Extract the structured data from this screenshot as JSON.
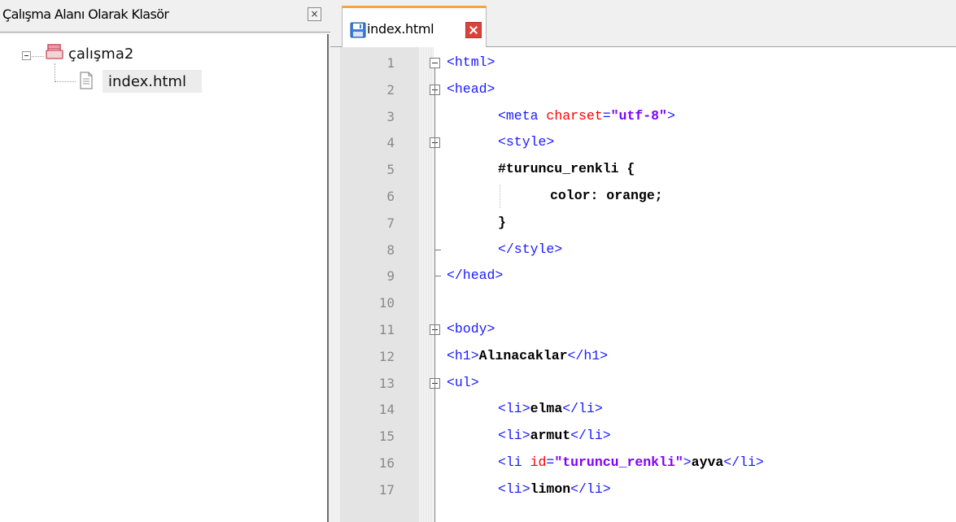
{
  "workspace": {
    "title": "Çalışma Alanı Olarak Klasör",
    "close_glyph": "×",
    "folder_name": "çalışma2",
    "file_name": "index.html"
  },
  "editor": {
    "tab_label": "index.html",
    "lines": [
      {
        "num": "1",
        "indent": 0,
        "tokens": [
          {
            "t": "tag",
            "v": "<html>"
          }
        ]
      },
      {
        "num": "2",
        "indent": 0,
        "tokens": [
          {
            "t": "tag",
            "v": "<head>"
          }
        ]
      },
      {
        "num": "3",
        "indent": 1,
        "tokens": [
          {
            "t": "tag",
            "v": "<meta "
          },
          {
            "t": "attr",
            "v": "charset"
          },
          {
            "t": "tag",
            "v": "="
          },
          {
            "t": "val",
            "v": "\"utf-8\""
          },
          {
            "t": "tag",
            "v": ">"
          }
        ]
      },
      {
        "num": "4",
        "indent": 1,
        "tokens": [
          {
            "t": "tag",
            "v": "<style>"
          }
        ]
      },
      {
        "num": "5",
        "indent": 1,
        "tokens": [
          {
            "t": "text",
            "v": "#turuncu_renkli {"
          }
        ]
      },
      {
        "num": "6",
        "indent": 2,
        "tokens": [
          {
            "t": "text",
            "v": "color: orange;"
          }
        ]
      },
      {
        "num": "7",
        "indent": 1,
        "tokens": [
          {
            "t": "text",
            "v": "}"
          }
        ]
      },
      {
        "num": "8",
        "indent": 1,
        "tokens": [
          {
            "t": "tag",
            "v": "</style>"
          }
        ]
      },
      {
        "num": "9",
        "indent": 0,
        "tokens": [
          {
            "t": "tag",
            "v": "</head>"
          }
        ]
      },
      {
        "num": "10",
        "indent": 0,
        "tokens": []
      },
      {
        "num": "11",
        "indent": 0,
        "tokens": [
          {
            "t": "tag",
            "v": "<body>"
          }
        ]
      },
      {
        "num": "12",
        "indent": 0,
        "tokens": [
          {
            "t": "tag",
            "v": "<h1>"
          },
          {
            "t": "text",
            "v": "Alınacaklar"
          },
          {
            "t": "tag",
            "v": "</h1>"
          }
        ]
      },
      {
        "num": "13",
        "indent": 0,
        "tokens": [
          {
            "t": "tag",
            "v": "<ul>"
          }
        ]
      },
      {
        "num": "14",
        "indent": 1,
        "tokens": [
          {
            "t": "tag",
            "v": "<li>"
          },
          {
            "t": "text",
            "v": "elma"
          },
          {
            "t": "tag",
            "v": "</li>"
          }
        ]
      },
      {
        "num": "15",
        "indent": 1,
        "tokens": [
          {
            "t": "tag",
            "v": "<li>"
          },
          {
            "t": "text",
            "v": "armut"
          },
          {
            "t": "tag",
            "v": "</li>"
          }
        ]
      },
      {
        "num": "16",
        "indent": 1,
        "tokens": [
          {
            "t": "tag",
            "v": "<li "
          },
          {
            "t": "attr",
            "v": "id"
          },
          {
            "t": "tag",
            "v": "="
          },
          {
            "t": "val",
            "v": "\"turuncu_renkli\""
          },
          {
            "t": "tag",
            "v": ">"
          },
          {
            "t": "text",
            "v": "ayva"
          },
          {
            "t": "tag",
            "v": "</li>"
          }
        ]
      },
      {
        "num": "17",
        "indent": 1,
        "tokens": [
          {
            "t": "tag",
            "v": "<li>"
          },
          {
            "t": "text",
            "v": "limon"
          },
          {
            "t": "tag",
            "v": "</li>"
          }
        ]
      }
    ]
  },
  "colors": {
    "tag": "#1a1aff",
    "attribute": "#ff0000",
    "value": "#8000ff",
    "tab_accent": "#f7a53b",
    "tab_close": "#d9443a"
  }
}
